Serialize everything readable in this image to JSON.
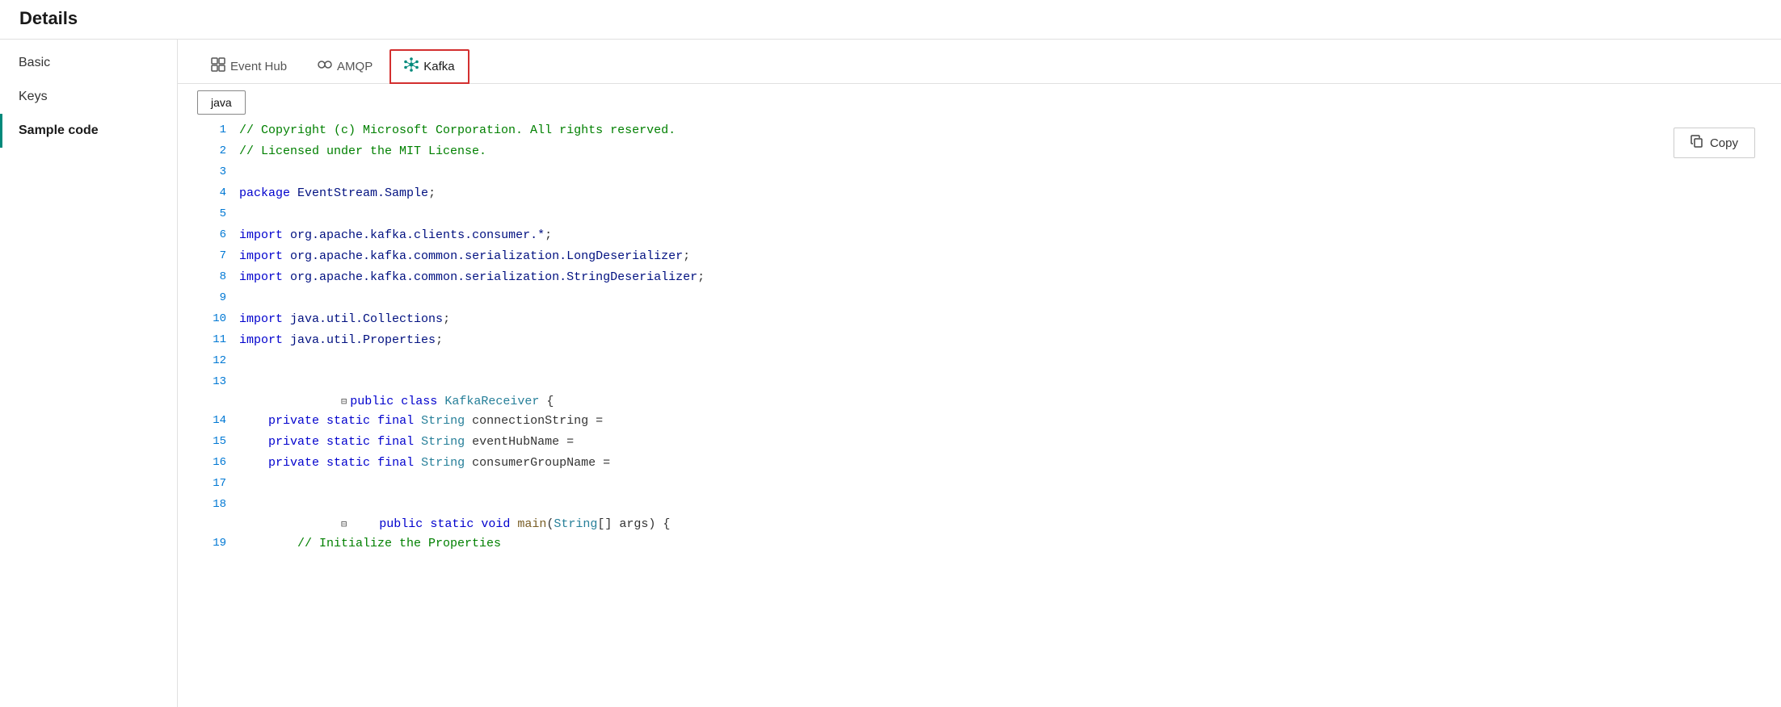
{
  "page": {
    "title": "Details"
  },
  "sidebar": {
    "items": [
      {
        "id": "basic",
        "label": "Basic",
        "active": false
      },
      {
        "id": "keys",
        "label": "Keys",
        "active": false
      },
      {
        "id": "sample-code",
        "label": "Sample code",
        "active": true
      }
    ]
  },
  "protocol_tabs": [
    {
      "id": "event-hub",
      "label": "Event Hub",
      "icon": "⊞",
      "active": false
    },
    {
      "id": "amqp",
      "label": "AMQP",
      "icon": "◇◇",
      "active": false
    },
    {
      "id": "kafka",
      "label": "Kafka",
      "icon": "✦",
      "active": true
    }
  ],
  "language_tabs": [
    {
      "id": "java",
      "label": "java",
      "active": true
    }
  ],
  "copy_button": {
    "label": "Copy",
    "icon": "copy-icon"
  },
  "code_lines": [
    {
      "num": "1",
      "content": "// Copyright (c) Microsoft Corporation. All rights reserved.",
      "type": "comment"
    },
    {
      "num": "2",
      "content": "// Licensed under the MIT License.",
      "type": "comment"
    },
    {
      "num": "3",
      "content": "",
      "type": "empty"
    },
    {
      "num": "4",
      "content": "package EventStream.Sample;",
      "type": "package"
    },
    {
      "num": "5",
      "content": "",
      "type": "empty"
    },
    {
      "num": "6",
      "content": "import org.apache.kafka.clients.consumer.*;",
      "type": "import"
    },
    {
      "num": "7",
      "content": "import org.apache.kafka.common.serialization.LongDeserializer;",
      "type": "import"
    },
    {
      "num": "8",
      "content": "import org.apache.kafka.common.serialization.StringDeserializer;",
      "type": "import"
    },
    {
      "num": "9",
      "content": "",
      "type": "empty"
    },
    {
      "num": "10",
      "content": "import java.util.Collections;",
      "type": "import"
    },
    {
      "num": "11",
      "content": "import java.util.Properties;",
      "type": "import"
    },
    {
      "num": "12",
      "content": "",
      "type": "empty"
    },
    {
      "num": "13",
      "content": "public class KafkaReceiver {",
      "type": "class",
      "foldable": true
    },
    {
      "num": "14",
      "content": "    private static final String connectionString =",
      "type": "field"
    },
    {
      "num": "15",
      "content": "    private static final String eventHubName =",
      "type": "field"
    },
    {
      "num": "16",
      "content": "    private static final String consumerGroupName =",
      "type": "field"
    },
    {
      "num": "17",
      "content": "",
      "type": "empty"
    },
    {
      "num": "18",
      "content": "    public static void main(String[] args) {",
      "type": "method",
      "foldable": true
    },
    {
      "num": "19",
      "content": "        // Initialize the Properties",
      "type": "comment-indented"
    }
  ]
}
